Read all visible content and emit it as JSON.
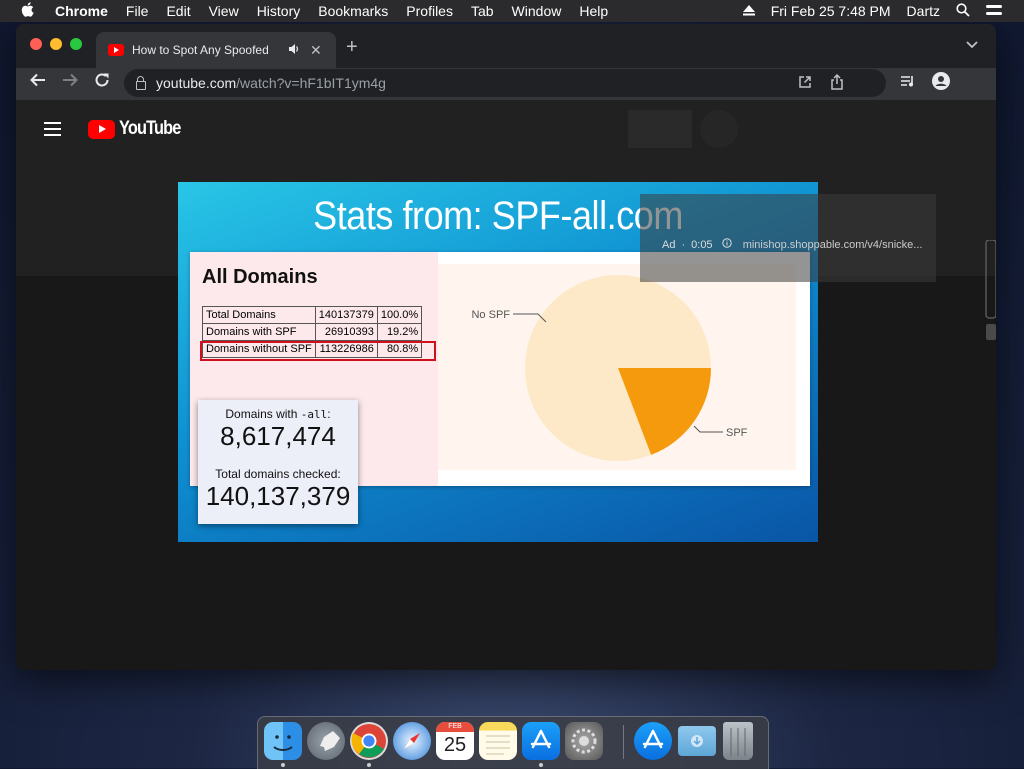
{
  "menubar": {
    "app_name": "Chrome",
    "menus": [
      "File",
      "Edit",
      "View",
      "History",
      "Bookmarks",
      "Profiles",
      "Tab",
      "Window",
      "Help"
    ],
    "datetime": "Fri Feb 25  7:48 PM",
    "user": "Dartz"
  },
  "browser": {
    "tab_title": "How to Spot Any Spoofed",
    "url_domain": "youtube.com",
    "url_path": "/watch?v=hF1bIT1ym4g"
  },
  "youtube": {
    "logo_text": "YouTube"
  },
  "slide": {
    "title": "Stats from: SPF-all.com",
    "heading": "All Domains",
    "table": [
      {
        "label": "Total Domains",
        "count": "140137379",
        "pct": "100.0%"
      },
      {
        "label": "Domains with SPF",
        "count": "26910393",
        "pct": "19.2%"
      },
      {
        "label": "Domains without SPF",
        "count": "113226986",
        "pct": "80.8%"
      }
    ],
    "callout": {
      "label1_prefix": "Domains with ",
      "label1_code": "-all",
      "label1_suffix": ":",
      "value1": "8,617,474",
      "label2": "Total domains checked:",
      "value2": "140,137,379"
    }
  },
  "chart_data": {
    "type": "pie",
    "slices": [
      {
        "label": "No SPF",
        "value": 80.8,
        "color": "#fde9c7"
      },
      {
        "label": "SPF",
        "value": 19.2,
        "color": "#f59a0c"
      }
    ]
  },
  "ad": {
    "label": "Ad",
    "time": "0:05",
    "url": "minishop.shoppable.com/v4/snicke..."
  },
  "dock": {
    "calendar_month": "FEB",
    "calendar_day": "25"
  }
}
